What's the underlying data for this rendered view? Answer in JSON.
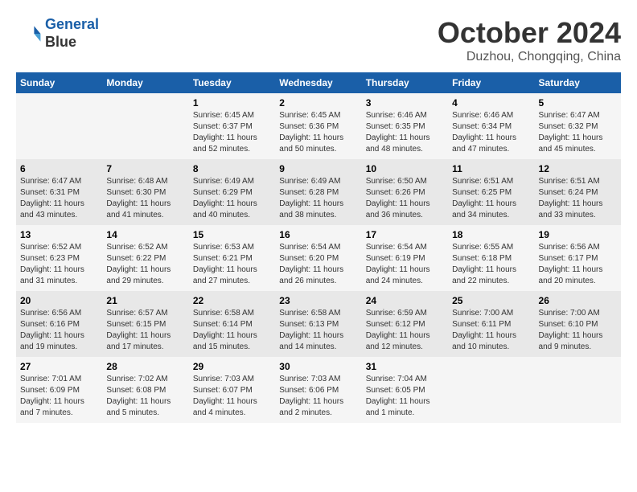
{
  "header": {
    "logo_line1": "General",
    "logo_line2": "Blue",
    "month": "October 2024",
    "location": "Duzhou, Chongqing, China"
  },
  "weekdays": [
    "Sunday",
    "Monday",
    "Tuesday",
    "Wednesday",
    "Thursday",
    "Friday",
    "Saturday"
  ],
  "weeks": [
    [
      {
        "day": "",
        "info": ""
      },
      {
        "day": "",
        "info": ""
      },
      {
        "day": "1",
        "info": "Sunrise: 6:45 AM\nSunset: 6:37 PM\nDaylight: 11 hours\nand 52 minutes."
      },
      {
        "day": "2",
        "info": "Sunrise: 6:45 AM\nSunset: 6:36 PM\nDaylight: 11 hours\nand 50 minutes."
      },
      {
        "day": "3",
        "info": "Sunrise: 6:46 AM\nSunset: 6:35 PM\nDaylight: 11 hours\nand 48 minutes."
      },
      {
        "day": "4",
        "info": "Sunrise: 6:46 AM\nSunset: 6:34 PM\nDaylight: 11 hours\nand 47 minutes."
      },
      {
        "day": "5",
        "info": "Sunrise: 6:47 AM\nSunset: 6:32 PM\nDaylight: 11 hours\nand 45 minutes."
      }
    ],
    [
      {
        "day": "6",
        "info": "Sunrise: 6:47 AM\nSunset: 6:31 PM\nDaylight: 11 hours\nand 43 minutes."
      },
      {
        "day": "7",
        "info": "Sunrise: 6:48 AM\nSunset: 6:30 PM\nDaylight: 11 hours\nand 41 minutes."
      },
      {
        "day": "8",
        "info": "Sunrise: 6:49 AM\nSunset: 6:29 PM\nDaylight: 11 hours\nand 40 minutes."
      },
      {
        "day": "9",
        "info": "Sunrise: 6:49 AM\nSunset: 6:28 PM\nDaylight: 11 hours\nand 38 minutes."
      },
      {
        "day": "10",
        "info": "Sunrise: 6:50 AM\nSunset: 6:26 PM\nDaylight: 11 hours\nand 36 minutes."
      },
      {
        "day": "11",
        "info": "Sunrise: 6:51 AM\nSunset: 6:25 PM\nDaylight: 11 hours\nand 34 minutes."
      },
      {
        "day": "12",
        "info": "Sunrise: 6:51 AM\nSunset: 6:24 PM\nDaylight: 11 hours\nand 33 minutes."
      }
    ],
    [
      {
        "day": "13",
        "info": "Sunrise: 6:52 AM\nSunset: 6:23 PM\nDaylight: 11 hours\nand 31 minutes."
      },
      {
        "day": "14",
        "info": "Sunrise: 6:52 AM\nSunset: 6:22 PM\nDaylight: 11 hours\nand 29 minutes."
      },
      {
        "day": "15",
        "info": "Sunrise: 6:53 AM\nSunset: 6:21 PM\nDaylight: 11 hours\nand 27 minutes."
      },
      {
        "day": "16",
        "info": "Sunrise: 6:54 AM\nSunset: 6:20 PM\nDaylight: 11 hours\nand 26 minutes."
      },
      {
        "day": "17",
        "info": "Sunrise: 6:54 AM\nSunset: 6:19 PM\nDaylight: 11 hours\nand 24 minutes."
      },
      {
        "day": "18",
        "info": "Sunrise: 6:55 AM\nSunset: 6:18 PM\nDaylight: 11 hours\nand 22 minutes."
      },
      {
        "day": "19",
        "info": "Sunrise: 6:56 AM\nSunset: 6:17 PM\nDaylight: 11 hours\nand 20 minutes."
      }
    ],
    [
      {
        "day": "20",
        "info": "Sunrise: 6:56 AM\nSunset: 6:16 PM\nDaylight: 11 hours\nand 19 minutes."
      },
      {
        "day": "21",
        "info": "Sunrise: 6:57 AM\nSunset: 6:15 PM\nDaylight: 11 hours\nand 17 minutes."
      },
      {
        "day": "22",
        "info": "Sunrise: 6:58 AM\nSunset: 6:14 PM\nDaylight: 11 hours\nand 15 minutes."
      },
      {
        "day": "23",
        "info": "Sunrise: 6:58 AM\nSunset: 6:13 PM\nDaylight: 11 hours\nand 14 minutes."
      },
      {
        "day": "24",
        "info": "Sunrise: 6:59 AM\nSunset: 6:12 PM\nDaylight: 11 hours\nand 12 minutes."
      },
      {
        "day": "25",
        "info": "Sunrise: 7:00 AM\nSunset: 6:11 PM\nDaylight: 11 hours\nand 10 minutes."
      },
      {
        "day": "26",
        "info": "Sunrise: 7:00 AM\nSunset: 6:10 PM\nDaylight: 11 hours\nand 9 minutes."
      }
    ],
    [
      {
        "day": "27",
        "info": "Sunrise: 7:01 AM\nSunset: 6:09 PM\nDaylight: 11 hours\nand 7 minutes."
      },
      {
        "day": "28",
        "info": "Sunrise: 7:02 AM\nSunset: 6:08 PM\nDaylight: 11 hours\nand 5 minutes."
      },
      {
        "day": "29",
        "info": "Sunrise: 7:03 AM\nSunset: 6:07 PM\nDaylight: 11 hours\nand 4 minutes."
      },
      {
        "day": "30",
        "info": "Sunrise: 7:03 AM\nSunset: 6:06 PM\nDaylight: 11 hours\nand 2 minutes."
      },
      {
        "day": "31",
        "info": "Sunrise: 7:04 AM\nSunset: 6:05 PM\nDaylight: 11 hours\nand 1 minute."
      },
      {
        "day": "",
        "info": ""
      },
      {
        "day": "",
        "info": ""
      }
    ]
  ]
}
